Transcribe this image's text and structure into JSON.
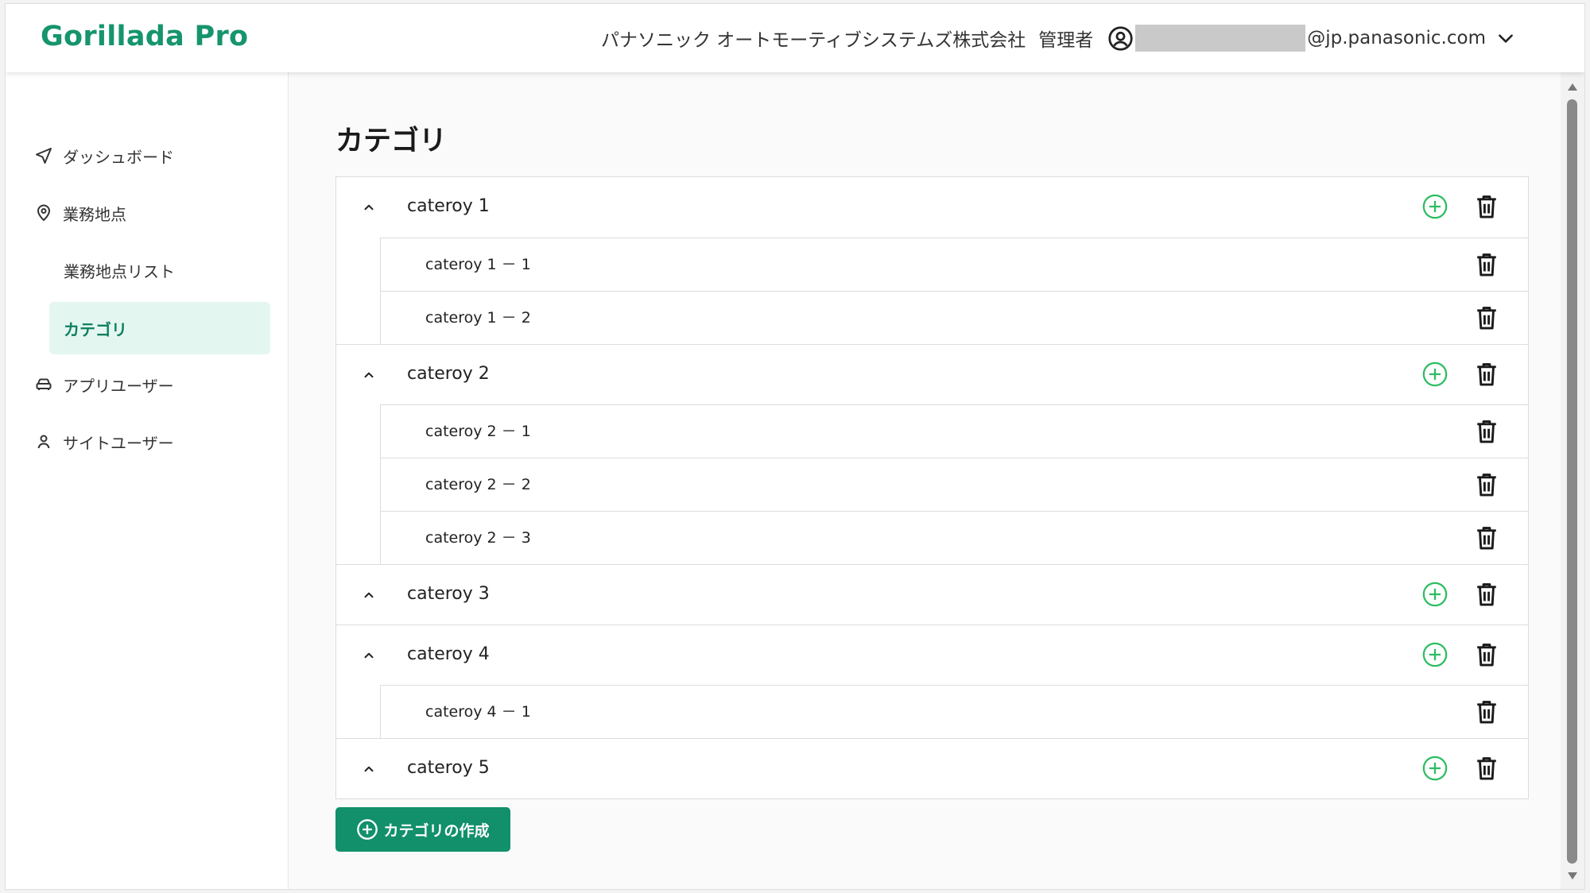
{
  "header": {
    "logo": "Gorillada Pro",
    "company": "パナソニック オートモーティブシステムズ株式会社",
    "role": "管理者",
    "email_domain": "@jp.panasonic.com"
  },
  "sidebar": {
    "items": [
      {
        "label": "ダッシュボード",
        "icon": "navigation-arrow-icon"
      },
      {
        "label": "業務地点",
        "icon": "location-pin-icon"
      },
      {
        "label": "業務地点リスト"
      },
      {
        "label": "カテゴリ"
      },
      {
        "label": "アプリユーザー",
        "icon": "car-icon"
      },
      {
        "label": "サイトユーザー",
        "icon": "person-icon"
      }
    ],
    "active_item": "カテゴリ"
  },
  "main": {
    "title": "カテゴリ",
    "categories": [
      {
        "name": "cateroy 1",
        "children": [
          "cateroy 1 － 1",
          "cateroy 1 － 2"
        ]
      },
      {
        "name": "cateroy 2",
        "children": [
          "cateroy 2 － 1",
          "cateroy 2 － 2",
          "cateroy 2 － 3"
        ]
      },
      {
        "name": "cateroy 3",
        "children": []
      },
      {
        "name": "cateroy 4",
        "children": [
          "cateroy 4 － 1"
        ]
      },
      {
        "name": "cateroy 5",
        "children": []
      }
    ],
    "create_button": "カテゴリの作成"
  },
  "colors": {
    "brand": "#16946e",
    "button": "#11906b",
    "add_icon": "#2ebd62",
    "active_bg": "#e4f6f0"
  }
}
